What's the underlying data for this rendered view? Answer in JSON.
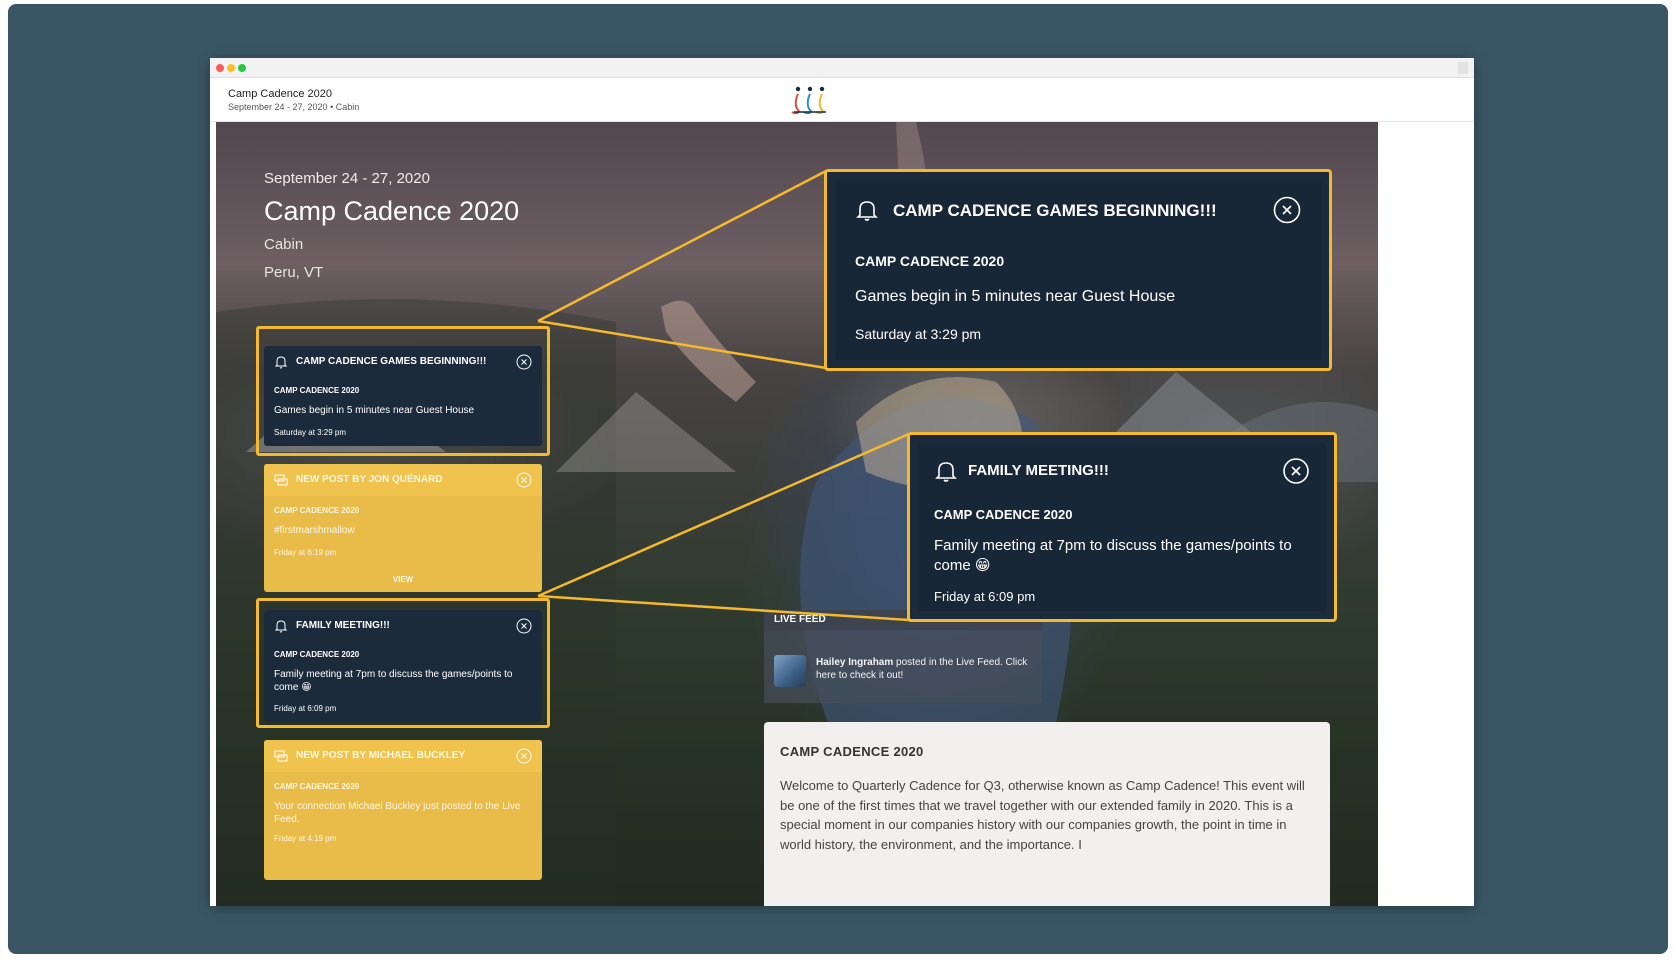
{
  "header": {
    "title": "Camp Cadence 2020",
    "subtitle": "September 24 - 27, 2020  •  Cabin"
  },
  "hero": {
    "date": "September 24 - 27, 2020",
    "title": "Camp Cadence 2020",
    "venue": "Cabin",
    "location": "Peru, VT"
  },
  "notifications": [
    {
      "type": "alert",
      "title": "CAMP CADENCE GAMES BEGINNING!!!",
      "org": "CAMP CADENCE 2020",
      "message": "Games begin in 5 minutes near Guest House",
      "time": "Saturday at 3:29 pm"
    },
    {
      "type": "post",
      "title": "NEW POST BY JON QUÉNARD",
      "org": "CAMP CADENCE 2020",
      "message": "#firstmarshmallow",
      "time": "Friday at 6:19 pm",
      "action": "VIEW"
    },
    {
      "type": "alert",
      "title": "FAMILY MEETING!!!",
      "org": "CAMP CADENCE 2020",
      "message": "Family meeting at 7pm to discuss the games/points to come 😁",
      "time": "Friday at 6:09 pm"
    },
    {
      "type": "post",
      "title": "NEW POST BY MICHAEL BUCKLEY",
      "org": "CAMP CADENCE 2020",
      "message": "Your connection Michael Buckley just posted to the Live Feed.",
      "time": "Friday at 4:19 pm"
    }
  ],
  "zoomed": [
    {
      "title": "CAMP CADENCE GAMES BEGINNING!!!",
      "org": "CAMP CADENCE 2020",
      "message": "Games begin in 5 minutes near Guest House",
      "time": "Saturday at 3:29 pm"
    },
    {
      "title": "FAMILY MEETING!!!",
      "org": "CAMP CADENCE 2020",
      "message": "Family meeting at 7pm to discuss the games/points to come 😁",
      "time": "Friday at 6:09 pm"
    }
  ],
  "live_feed": {
    "label": "LIVE FEED",
    "user": "Hailey Ingraham",
    "text": " posted in the Live Feed. Click here to check it out!"
  },
  "about": {
    "title": "CAMP CADENCE 2020",
    "body": "Welcome to Quarterly Cadence for Q3, otherwise known as Camp Cadence! This event will be one of the first times that we travel together with our extended family in 2020. This is a special moment in our companies history with our companies growth, the point in time in world history, the environment, and the importance. I"
  },
  "colors": {
    "frame_bg": "#3a5665",
    "highlight": "#f4b92d",
    "notif_dark": "#1c2b3b",
    "notif_yellow": "#e9bb48"
  },
  "icons": {
    "alert": "bell-icon",
    "post": "post-icon",
    "close": "close-circle-icon",
    "logo": "cadence-logo"
  }
}
